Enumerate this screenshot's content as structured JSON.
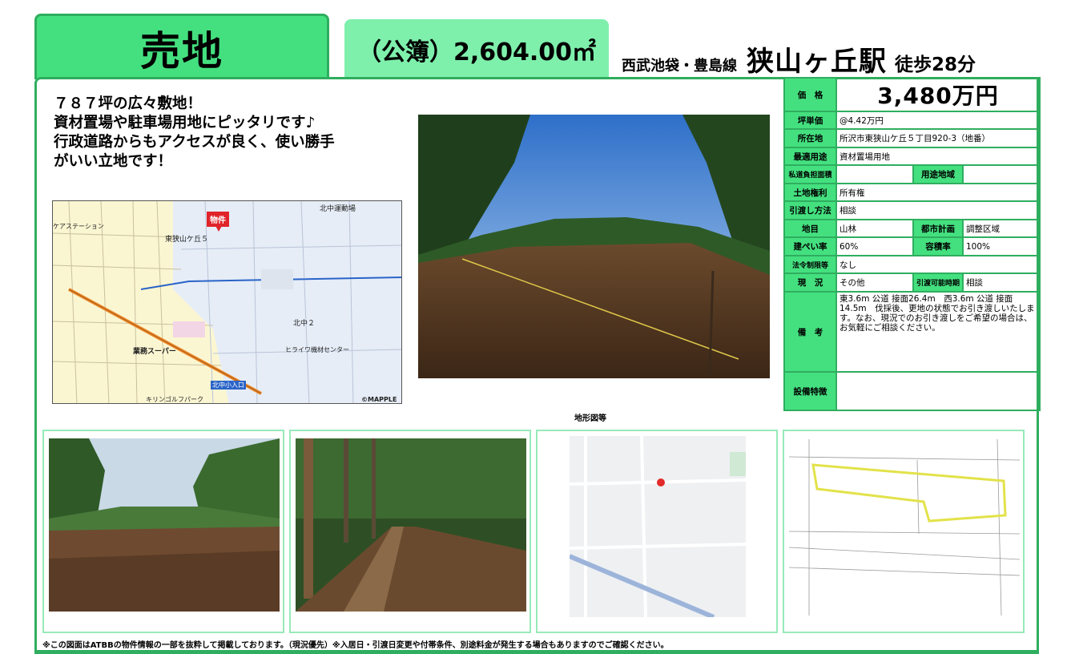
{
  "header": {
    "category": "売地",
    "area": "（公簿）2,604.00㎡",
    "line": "西武池袋・豊島線",
    "station": "狭山ヶ丘駅",
    "walk": "徒歩28分"
  },
  "headline": {
    "lines": [
      "７８７坪の広々敷地！",
      "資材置場や駐車場用地にピッタリです♪",
      "行政道路からもアクセスが良く、使い勝手",
      "がいい立地です！"
    ]
  },
  "map": {
    "pin_label": "物件",
    "labels": {
      "station": "ケアステーション",
      "area_higashi": "東狭山ケ丘５",
      "undojo": "北中運動場",
      "kitanaka2": "北中２",
      "supermarket": "業務スーパー",
      "iriguchi": "北中小入口",
      "golf": "キリンゴルフパーク",
      "center": "ヒライワ機材センター",
      "credit": "©MAPPLE"
    }
  },
  "spec": {
    "price_label": "価　格",
    "price": "3,480万円",
    "tsubo_label": "坪単価",
    "tsubo": "@4.42万円",
    "location_label": "所在地",
    "location": "所沢市東狭山ケ丘５丁目920-3（地番）",
    "use_label": "最適用途",
    "use": "資材置場用地",
    "private_road_label": "私道負担面積",
    "private_road": "",
    "zoning_label": "用途地域",
    "zoning": "",
    "land_right_label": "土地権利",
    "land_right": "所有権",
    "delivery_method_label": "引渡し方法",
    "delivery_method": "相談",
    "land_category_label": "地目",
    "land_category": "山林",
    "city_plan_label": "都市計画",
    "city_plan": "調整区域",
    "coverage_label": "建ぺい率",
    "coverage": "60%",
    "far_label": "容積率",
    "far": "100%",
    "legal_label": "法令制限等",
    "legal": "なし",
    "status_label": "現　況",
    "status": "その他",
    "delivery_time_label": "引渡可能時期",
    "delivery_time": "相談",
    "remarks_label": "備　考",
    "remarks": "東3.6m 公道 接面26.4m　西3.6m 公道 接面14.5m　伐採後、更地の状態でお引き渡しいたします。なお、現況でのお引き渡しをご希望の場合は、お気軽にご相談ください。",
    "equipment_label": "設備特徴",
    "equipment": ""
  },
  "terrain_title": "地形図等",
  "footer": "※この図面はATBBの物件情報の一部を抜粋して掲載しております。（現況優先）※入居日・引渡日変更や付帯条件、別途料金が発生する場合もありますのでご確認ください。"
}
